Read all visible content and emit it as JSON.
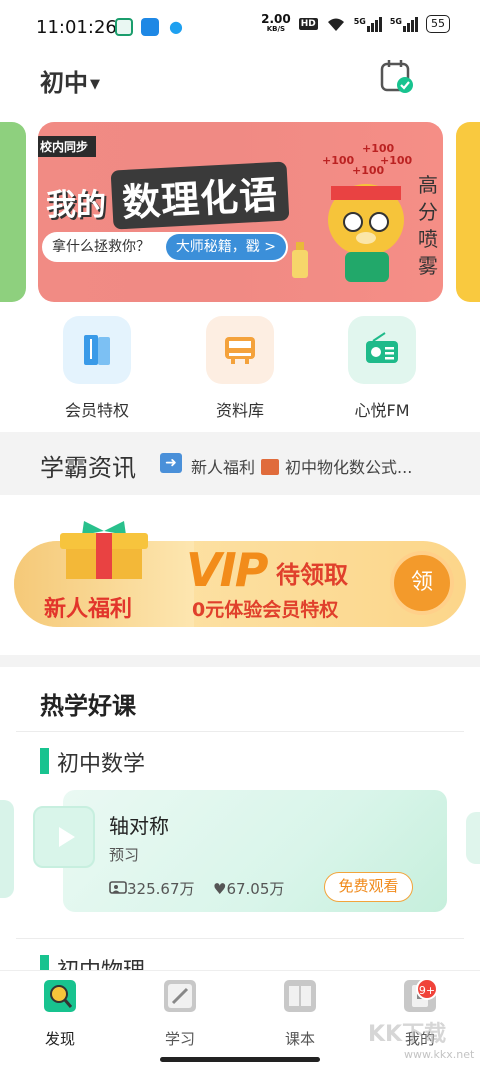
{
  "status_bar": {
    "time": "11:01:26",
    "net_speed_value": "2.00",
    "net_speed_unit": "KB/S",
    "hd_label": "HD",
    "signal1": "5G",
    "signal2": "5G",
    "battery": "55"
  },
  "header": {
    "grade": "初中"
  },
  "banner": {
    "tag": "校内同步",
    "title_prefix": "我的",
    "title_main": "数理化语",
    "prompt": "拿什么拯救你？",
    "action": "大师秘籍，戳 >",
    "plus1": "+100",
    "plus2": "+100",
    "plus3": "+100",
    "plus4": "+100",
    "side_text": "高分喷雾"
  },
  "quick_links": [
    {
      "label": "会员特权"
    },
    {
      "label": "资料库"
    },
    {
      "label": "心悦FM"
    }
  ],
  "news": {
    "heading": "学霸资讯",
    "item1": "新人福利",
    "item2": "初中物化数公式..."
  },
  "vip_banner": {
    "new_user": "新人福利",
    "vip": "VIP",
    "pending": "待领取",
    "subtitle": "0元体验会员特权",
    "claim": "领"
  },
  "hot_courses": {
    "heading": "热学好课",
    "sections": [
      {
        "name": "初中数学",
        "course": {
          "title": "轴对称",
          "type": "预习",
          "views": "325.67万",
          "likes": "67.05万",
          "cta": "免费观看"
        }
      },
      {
        "name": "初中物理"
      }
    ]
  },
  "tabbar": {
    "tabs": [
      {
        "label": "发现"
      },
      {
        "label": "学习"
      },
      {
        "label": "课本"
      },
      {
        "label": "我的"
      }
    ],
    "badge": "9+"
  },
  "watermark": {
    "brand": "KK下载",
    "url": "www.kkx.net"
  },
  "colors": {
    "accent_green": "#18c38f",
    "banner_pink": "#f18b84",
    "vip_orange": "#f39a2b",
    "badge_red": "#f0433a"
  }
}
